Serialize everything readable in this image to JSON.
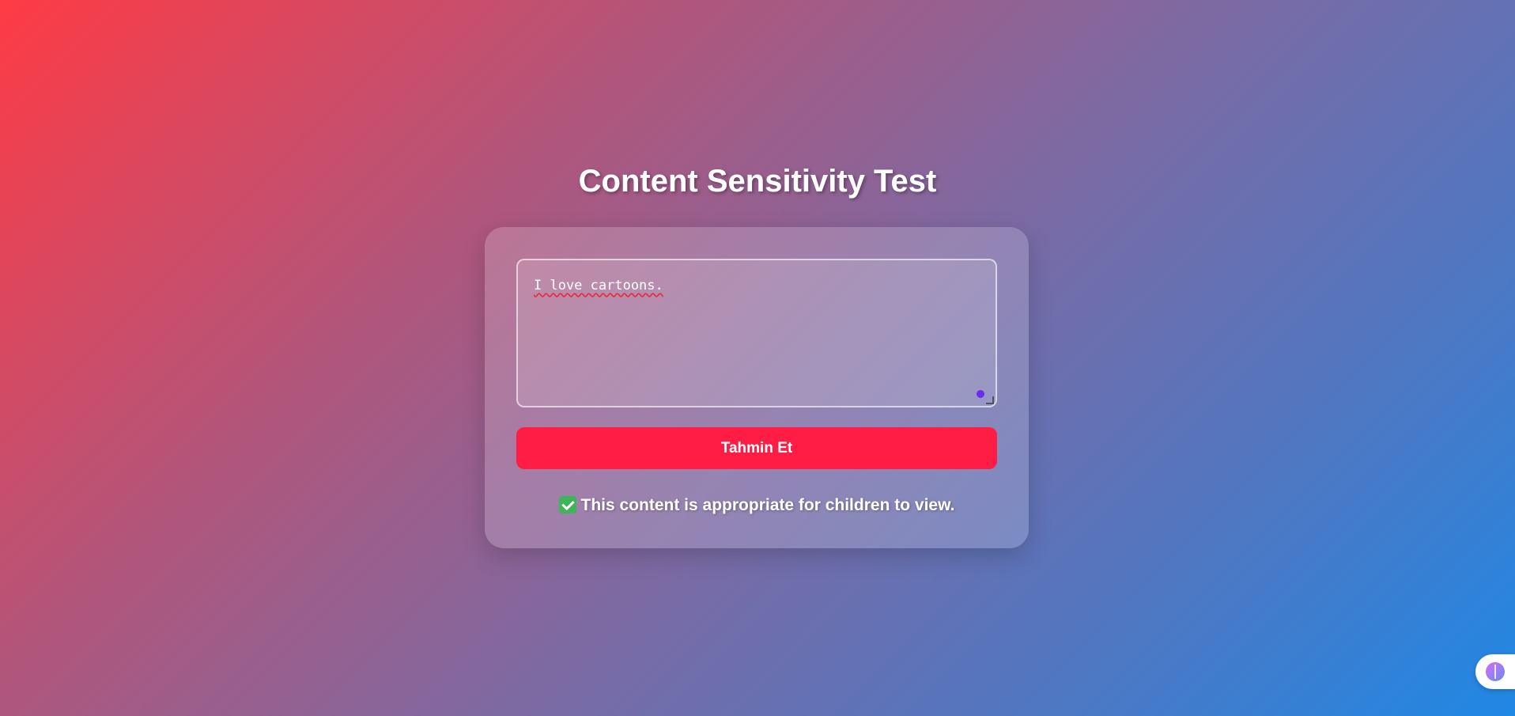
{
  "header": {
    "title": "Content Sensitivity Test"
  },
  "form": {
    "text_value": "I love cartoons.",
    "submit_label": "Tahmin Et"
  },
  "result": {
    "icon": "check-box-icon",
    "message": "This content is appropriate for children to view."
  },
  "widget": {
    "icon": "brain-icon"
  }
}
